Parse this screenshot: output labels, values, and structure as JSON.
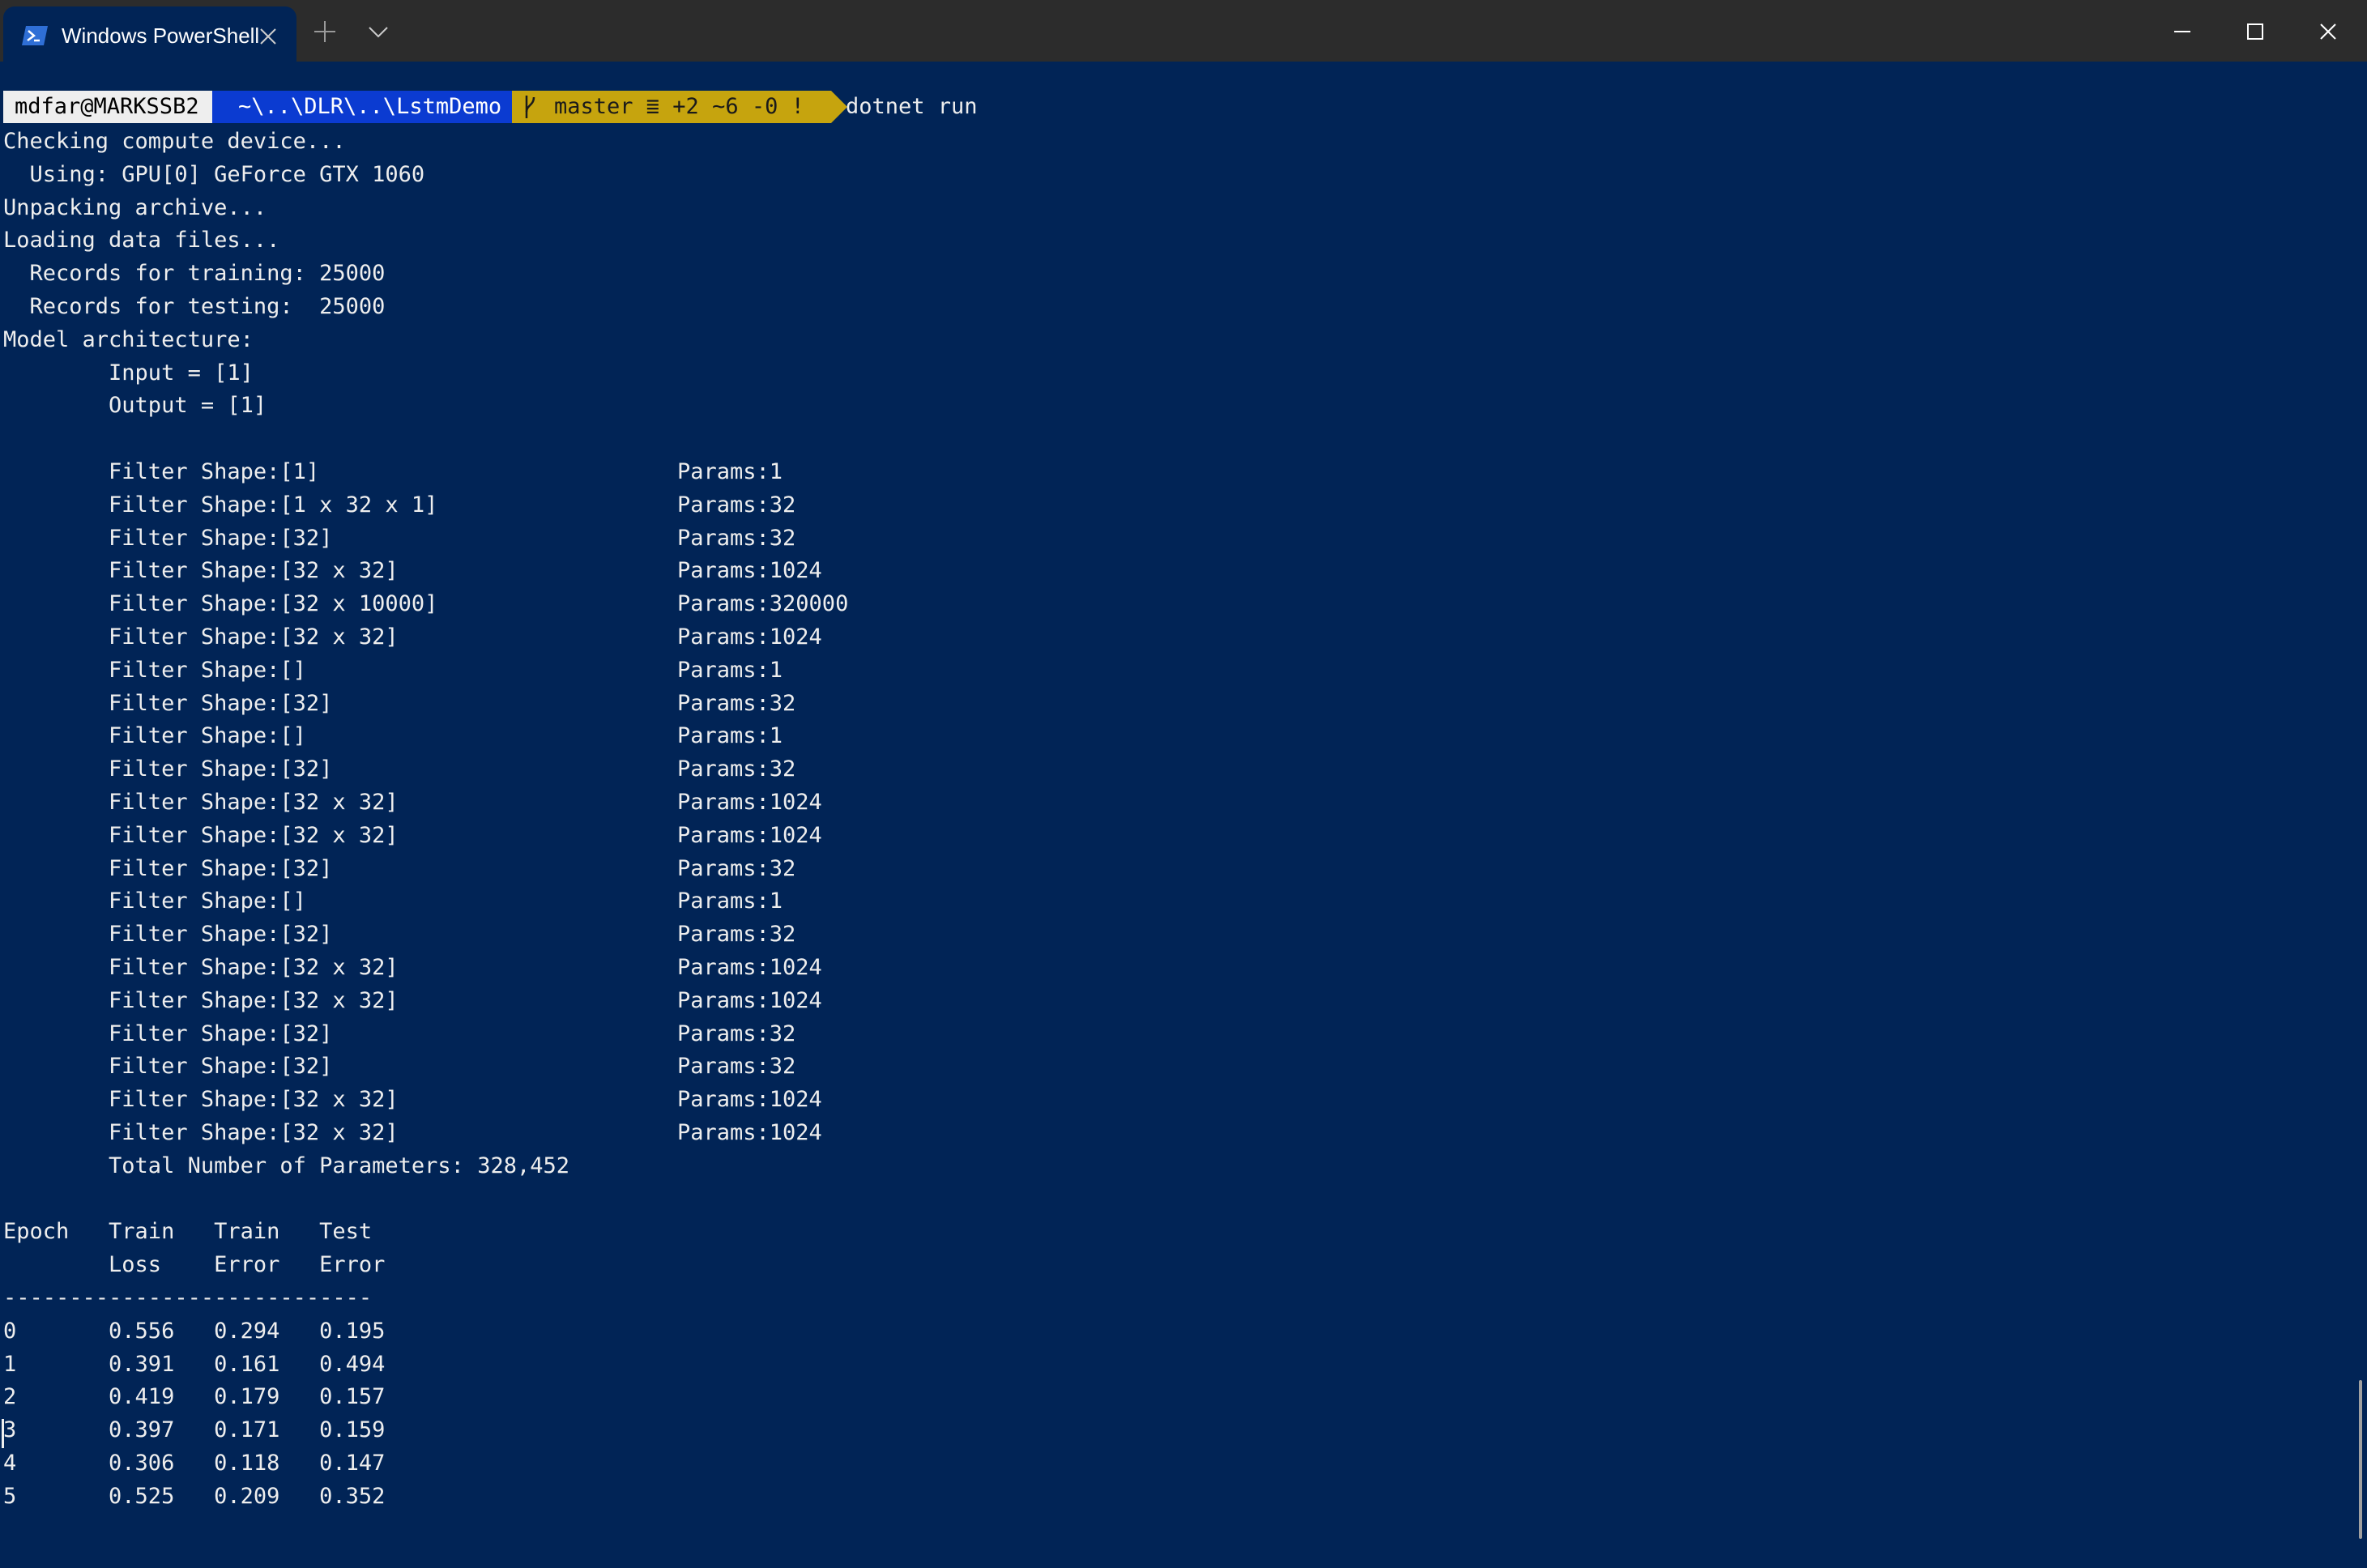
{
  "titlebar": {
    "tab_title": "Windows PowerShell",
    "icons": [
      "powershell-icon",
      "close-icon",
      "plus-icon",
      "chevron-down-icon",
      "minimize-icon",
      "maximize-icon",
      "close-window-icon"
    ]
  },
  "prompt": {
    "user": "mdfar@MARKSSB2",
    "path": "~\\..\\DLR\\..\\LstmDemo",
    "git": "master ≣ +2 ~6 -0 !",
    "command": "dotnet run",
    "colors": {
      "user_bg": "#eeeeee",
      "path_bg": "#0b3bd1",
      "git_bg": "#c6a40e",
      "terminal_bg": "#012456"
    }
  },
  "output": {
    "lines": [
      "Checking compute device...",
      "  Using: GPU[0] GeForce GTX 1060",
      "Unpacking archive...",
      "Loading data files...",
      "  Records for training: 25000",
      "  Records for testing:  25000",
      "Model architecture:",
      "        Input = [1]",
      "        Output = [1]",
      ""
    ],
    "filters": [
      {
        "shape": "        Filter Shape:[1]",
        "params": "Params:1"
      },
      {
        "shape": "        Filter Shape:[1 x 32 x 1]",
        "params": "Params:32"
      },
      {
        "shape": "        Filter Shape:[32]",
        "params": "Params:32"
      },
      {
        "shape": "        Filter Shape:[32 x 32]",
        "params": "Params:1024"
      },
      {
        "shape": "        Filter Shape:[32 x 10000]",
        "params": "Params:320000"
      },
      {
        "shape": "        Filter Shape:[32 x 32]",
        "params": "Params:1024"
      },
      {
        "shape": "        Filter Shape:[]",
        "params": "Params:1"
      },
      {
        "shape": "        Filter Shape:[32]",
        "params": "Params:32"
      },
      {
        "shape": "        Filter Shape:[]",
        "params": "Params:1"
      },
      {
        "shape": "        Filter Shape:[32]",
        "params": "Params:32"
      },
      {
        "shape": "        Filter Shape:[32 x 32]",
        "params": "Params:1024"
      },
      {
        "shape": "        Filter Shape:[32 x 32]",
        "params": "Params:1024"
      },
      {
        "shape": "        Filter Shape:[32]",
        "params": "Params:32"
      },
      {
        "shape": "        Filter Shape:[]",
        "params": "Params:1"
      },
      {
        "shape": "        Filter Shape:[32]",
        "params": "Params:32"
      },
      {
        "shape": "        Filter Shape:[32 x 32]",
        "params": "Params:1024"
      },
      {
        "shape": "        Filter Shape:[32 x 32]",
        "params": "Params:1024"
      },
      {
        "shape": "        Filter Shape:[32]",
        "params": "Params:32"
      },
      {
        "shape": "        Filter Shape:[32]",
        "params": "Params:32"
      },
      {
        "shape": "        Filter Shape:[32 x 32]",
        "params": "Params:1024"
      },
      {
        "shape": "        Filter Shape:[32 x 32]",
        "params": "Params:1024"
      }
    ],
    "total": "        Total Number of Parameters: 328,452",
    "table_header": [
      "Epoch   Train   Train   Test",
      "        Loss    Error   Error",
      "----------------------------"
    ],
    "epochs": [
      "0       0.556   0.294   0.195",
      "1       0.391   0.161   0.494",
      "2       0.419   0.179   0.157",
      "3       0.397   0.171   0.159",
      "4       0.306   0.118   0.147",
      "5       0.525   0.209   0.352"
    ]
  }
}
